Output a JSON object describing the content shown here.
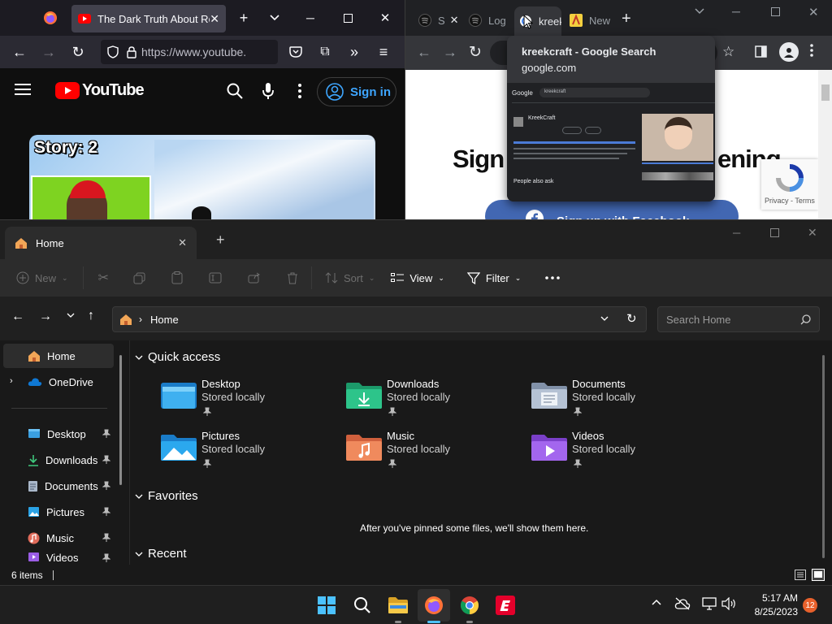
{
  "firefox": {
    "active_tab_title": "The Dark Truth About Roblox",
    "url": "https://www.youtube.com",
    "yt_logo_text": "YouTube",
    "signin_label": "Sign in",
    "video_overlay_text": "Story: 2"
  },
  "chrome": {
    "tabs": [
      {
        "label": "S"
      },
      {
        "label": "Log"
      },
      {
        "label": "kreek"
      },
      {
        "label": "New"
      }
    ],
    "hover_card": {
      "title": "kreekcraft - Google Search",
      "domain": "google.com",
      "preview_search": "kreekcraft",
      "preview_result": "KreekCraft",
      "preview_people": "People also ask"
    },
    "page_heading": "Sign u",
    "page_heading_right": "ening",
    "recaptcha_text": "Privacy - Terms",
    "facebook_btn": "Sign up with Facebook"
  },
  "explorer": {
    "tab_title": "Home",
    "commands": {
      "new": "New",
      "sort": "Sort",
      "view": "View",
      "filter": "Filter"
    },
    "address": "Home",
    "search_placeholder": "Search Home",
    "sidebar": [
      {
        "label": "Home"
      },
      {
        "label": "OneDrive"
      },
      {
        "label": "Desktop"
      },
      {
        "label": "Downloads"
      },
      {
        "label": "Documents"
      },
      {
        "label": "Pictures"
      },
      {
        "label": "Music"
      },
      {
        "label": "Videos"
      }
    ],
    "quick_access_title": "Quick access",
    "quick_access": [
      {
        "name": "Desktop",
        "sub": "Stored locally"
      },
      {
        "name": "Downloads",
        "sub": "Stored locally"
      },
      {
        "name": "Documents",
        "sub": "Stored locally"
      },
      {
        "name": "Pictures",
        "sub": "Stored locally"
      },
      {
        "name": "Music",
        "sub": "Stored locally"
      },
      {
        "name": "Videos",
        "sub": "Stored locally"
      }
    ],
    "favorites_title": "Favorites",
    "favorites_empty": "After you've pinned some files, we'll show them here.",
    "recent_title": "Recent",
    "status": "6 items"
  },
  "taskbar": {
    "time": "5:17 AM",
    "date": "8/25/2023",
    "notif_count": "12"
  },
  "colors": {
    "accent_blue": "#3ea6ff",
    "yt_red": "#ff0000",
    "win_blue": "#0078d4"
  }
}
